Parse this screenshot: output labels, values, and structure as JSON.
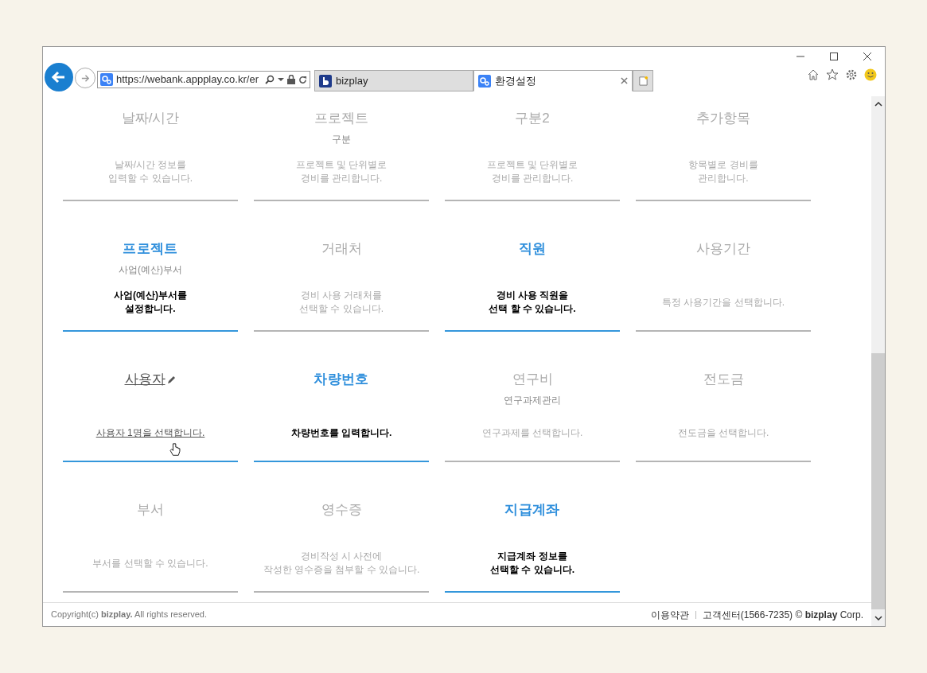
{
  "browser": {
    "address": "https://webank.appplay.co.kr/er",
    "tabs": [
      {
        "label": "bizplay",
        "selected": false,
        "kind": "bizplay"
      },
      {
        "label": "환경설정",
        "selected": true,
        "kind": "settings"
      }
    ]
  },
  "cards": [
    {
      "title": "날짜/시간",
      "description": "날짜/시간 정보를\n입력할 수 있습니다.",
      "selected": false,
      "hovered": false
    },
    {
      "title": "프로젝트",
      "subtitle": "구분",
      "description": "프로젝트 및 단위별로\n경비를 관리합니다.",
      "selected": false,
      "hovered": false
    },
    {
      "title": "구분2",
      "description": "프로젝트 및 단위별로\n경비를 관리합니다.",
      "selected": false,
      "hovered": false
    },
    {
      "title": "추가항목",
      "description": "항목별로 경비를\n관리합니다.",
      "selected": false,
      "hovered": false
    },
    {
      "title": "프로젝트",
      "subtitle": "사업(예산)부서",
      "description": "사업(예산)부서를\n설정합니다.",
      "selected": true,
      "hovered": false
    },
    {
      "title": "거래처",
      "description": "경비 사용 거래처를\n선택할 수 있습니다.",
      "selected": false,
      "hovered": false
    },
    {
      "title": "직원",
      "description": "경비 사용 직원을\n선택 할 수 있습니다.",
      "selected": true,
      "hovered": false
    },
    {
      "title": "사용기간",
      "description": "특정 사용기간을 선택합니다.",
      "selected": false,
      "hovered": false
    },
    {
      "title": "사용자",
      "description": "사용자 1명을 선택합니다.",
      "selected": false,
      "hovered": true
    },
    {
      "title": "차량번호",
      "description": "차량번호를 입력합니다.",
      "selected": true,
      "hovered": false
    },
    {
      "title": "연구비",
      "subtitle": "연구과제관리",
      "description": "연구과제를 선택합니다.",
      "selected": false,
      "hovered": false
    },
    {
      "title": "전도금",
      "description": "전도금을 선택합니다.",
      "selected": false,
      "hovered": false
    },
    {
      "title": "부서",
      "description": "부서를 선택할 수 있습니다.",
      "selected": false,
      "hovered": false
    },
    {
      "title": "영수증",
      "description": "경비작성 시 사전에\n작성한 영수증을 첨부할 수 있습니다.",
      "selected": false,
      "hovered": false
    },
    {
      "title": "지급계좌",
      "description": "지급계좌 정보를\n선택할 수 있습니다.",
      "selected": true,
      "hovered": false
    }
  ],
  "footer": {
    "copyright": "Copyright(c) **bizplay.** All rights reserved.",
    "links": [
      "이용약관",
      "고객센터(1566-7235) © **bizplay** Corp."
    ]
  }
}
